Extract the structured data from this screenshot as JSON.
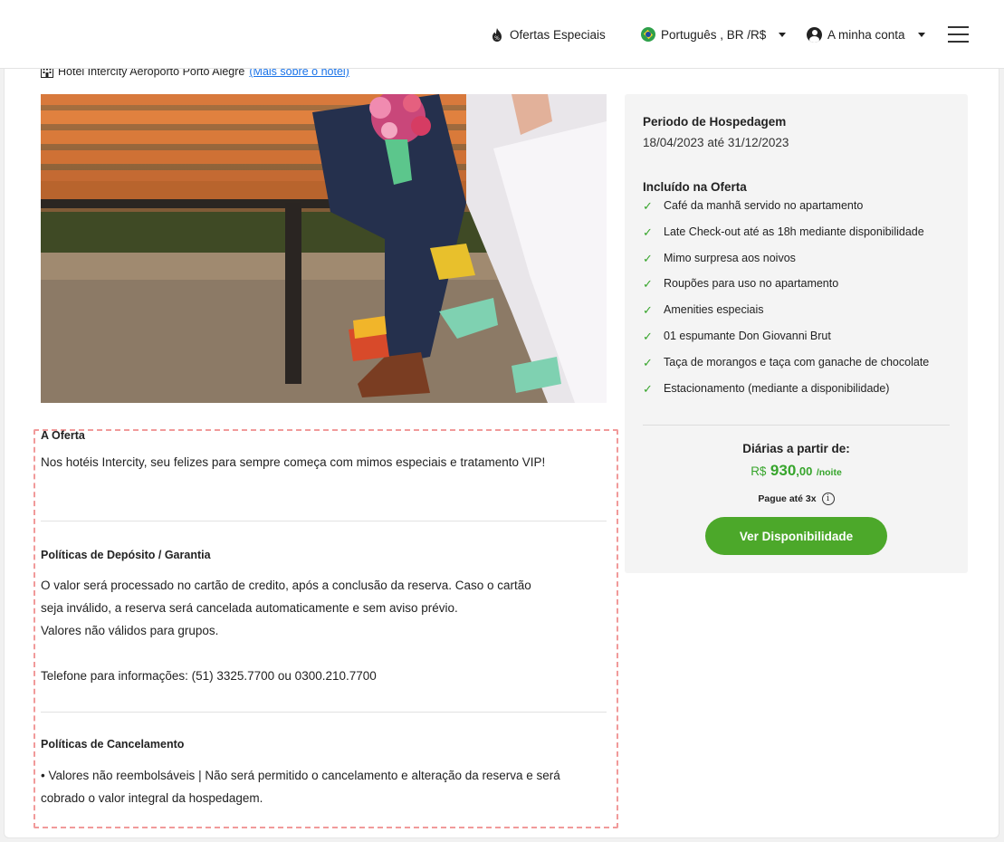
{
  "header": {
    "special_offers": "Ofertas Especiais",
    "language": "Português , BR /R$",
    "account": "A minha conta"
  },
  "hotel": {
    "name": "Hotel Intercity Aeroporto Porto Alegre",
    "more_link": "(Mais sobre o hotel)"
  },
  "sidebar": {
    "stay_title": "Periodo de Hospedagem",
    "stay_dates": "18/04/2023 até 31/12/2023",
    "included_title": "Incluído na Oferta",
    "included_items": [
      "Café da manhã servido no apartamento",
      "Late Check-out até as 18h mediante disponibilidade",
      "Mimo surpresa aos noivos",
      "Roupões para uso no apartamento",
      "Amenities especiais",
      "01 espumante Don Giovanni Brut",
      "Taça de morangos e taça com ganache de chocolate",
      "Estacionamento (mediante a disponibilidade)"
    ],
    "price_label": "Diárias a partir de:",
    "currency": "R$",
    "price_int": "930",
    "price_dec": ",00",
    "per_night": "/noite",
    "installments": "Pague até 3x",
    "button": "Ver Disponibilidade"
  },
  "content": {
    "offer_title": "A Oferta",
    "offer_text": "Nos hotéis Intercity, seu felizes para sempre começa com mimos especiais e tratamento VIP!",
    "deposit_title": "Políticas de Depósito / Garantia",
    "deposit_line1": "O valor será processado no cartão de credito, após a conclusão da reserva. Caso o cartão seja inválido, a reserva será cancelada automaticamente e sem aviso prévio.",
    "deposit_line2": "Valores não válidos para grupos.",
    "phone": "Telefone para informações: (51) 3325.7700 ou 0300.210.7700",
    "cancel_title": "Políticas de Cancelamento",
    "cancel_text": "• Valores não reembolsáveis | Não será permitido o cancelamento e alteração da reserva e será cobrado o valor integral da hospedagem."
  },
  "colors": {
    "accent_green": "#4ca82a",
    "price_green": "#37a52c",
    "link_blue": "#1a73e8",
    "dashed_border": "#f19a9a"
  }
}
